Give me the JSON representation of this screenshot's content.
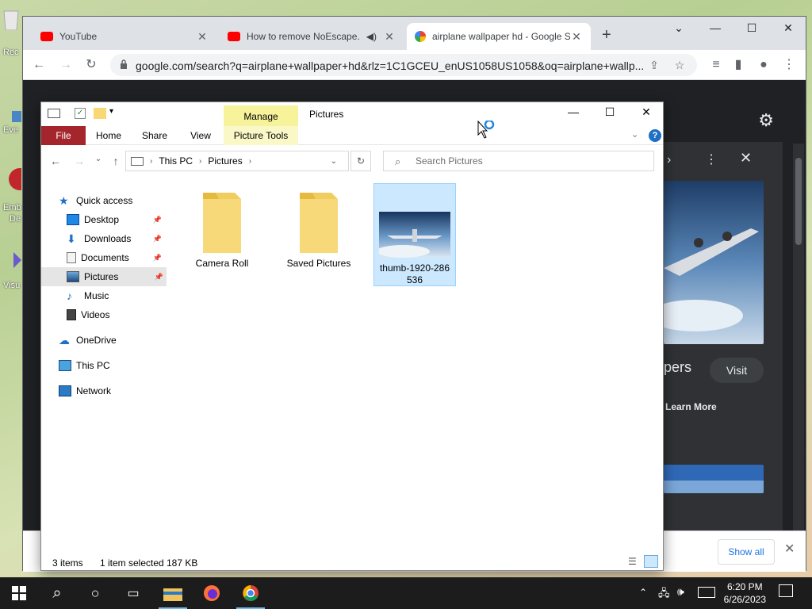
{
  "desktop": {
    "icons": [
      {
        "label": "Rec",
        "icon": "recycle-bin-icon"
      },
      {
        "label": "Eve",
        "icon": "app-icon"
      },
      {
        "label": "Emb",
        "icon": "app-icon"
      },
      {
        "label": "De",
        "icon": "app-icon"
      },
      {
        "label": "Visu",
        "icon": "app-icon"
      }
    ]
  },
  "chrome": {
    "tabs": [
      {
        "title": "YouTube",
        "favicon": "youtube-icon"
      },
      {
        "title": "How to remove NoEscape.ex",
        "favicon": "youtube-icon",
        "audio": true
      },
      {
        "title": "airplane wallpaper hd - Google S",
        "favicon": "google-icon",
        "active": true
      }
    ],
    "new_tab": "+",
    "url": "google.com/search?q=airplane+wallpaper+hd&rlz=1C1GCEU_enUS1058US1058&oq=airplane+wallp...",
    "page": {
      "visit_label": "Visit",
      "title_fragment": "pers",
      "learn_more": "Learn More"
    },
    "download_bar": {
      "show_all": "Show all"
    }
  },
  "explorer": {
    "window_title": "Pictures",
    "manage_label": "Manage",
    "ribbon_tabs": [
      "File",
      "Home",
      "Share",
      "View"
    ],
    "picture_tools": "Picture Tools",
    "breadcrumb": [
      "This PC",
      "Pictures"
    ],
    "search_placeholder": "Search Pictures",
    "nav": [
      {
        "label": "Quick access",
        "icon": "star-icon"
      },
      {
        "label": "Desktop",
        "icon": "desktop-icon",
        "pinned": true
      },
      {
        "label": "Downloads",
        "icon": "download-icon",
        "pinned": true
      },
      {
        "label": "Documents",
        "icon": "documents-icon",
        "pinned": true
      },
      {
        "label": "Pictures",
        "icon": "pictures-icon",
        "pinned": true,
        "selected": true
      },
      {
        "label": "Music",
        "icon": "music-icon"
      },
      {
        "label": "Videos",
        "icon": "videos-icon"
      },
      {
        "label": "OneDrive",
        "icon": "cloud-icon"
      },
      {
        "label": "This PC",
        "icon": "computer-icon"
      },
      {
        "label": "Network",
        "icon": "network-icon"
      }
    ],
    "files": [
      {
        "name": "Camera Roll",
        "type": "folder"
      },
      {
        "name": "Saved Pictures",
        "type": "folder"
      },
      {
        "name_line1": "thumb-1920-286",
        "name_line2": "536",
        "type": "image",
        "selected": true
      }
    ],
    "status": {
      "items": "3 items",
      "selected": "1 item selected",
      "size": "187 KB"
    }
  },
  "taskbar": {
    "time": "6:20 PM",
    "date": "6/26/2023"
  },
  "colors": {
    "file_tab": "#a4262c",
    "manage_tab": "#f7f39a",
    "selection": "#cce8ff",
    "chrome_dark": "#202124",
    "taskbar": "#1c1c1c"
  }
}
